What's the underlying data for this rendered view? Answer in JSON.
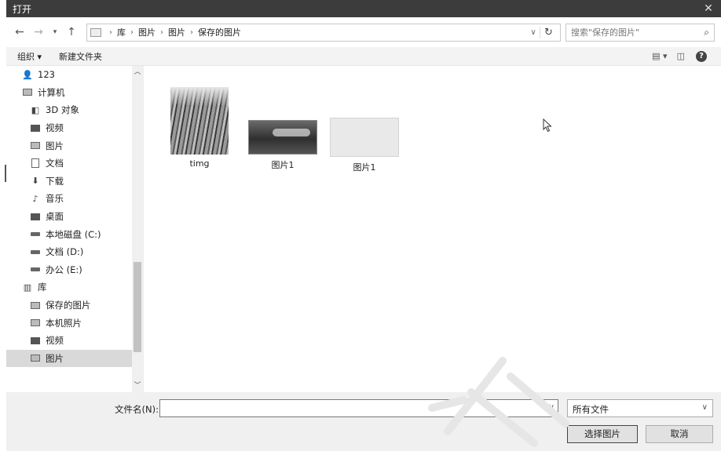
{
  "window": {
    "title": "打开",
    "close_glyph": "✕"
  },
  "address": {
    "crumbs": [
      "库",
      "图片",
      "图片",
      "保存的图片"
    ],
    "search_placeholder": "搜索\"保存的图片\""
  },
  "toolbar": {
    "organize": "组织 ▾",
    "new_folder": "新建文件夹",
    "view_toggle": "▤ ▾",
    "preview": "◫",
    "help": "?"
  },
  "sidebar": {
    "items": [
      {
        "label": "123",
        "icon": "user-icon"
      },
      {
        "label": "计算机",
        "icon": "computer-icon"
      },
      {
        "label": "3D 对象",
        "icon": "cube-icon"
      },
      {
        "label": "视频",
        "icon": "video-icon"
      },
      {
        "label": "图片",
        "icon": "pictures-icon"
      },
      {
        "label": "文档",
        "icon": "document-icon"
      },
      {
        "label": "下载",
        "icon": "download-icon"
      },
      {
        "label": "音乐",
        "icon": "music-icon"
      },
      {
        "label": "桌面",
        "icon": "desktop-icon"
      },
      {
        "label": "本地磁盘 (C:)",
        "icon": "drive-icon"
      },
      {
        "label": "文档 (D:)",
        "icon": "drive-icon"
      },
      {
        "label": "办公 (E:)",
        "icon": "drive-icon"
      },
      {
        "label": "库",
        "icon": "library-icon"
      },
      {
        "label": "保存的图片",
        "icon": "pictures-icon"
      },
      {
        "label": "本机照片",
        "icon": "pictures-icon"
      },
      {
        "label": "视频",
        "icon": "video-icon"
      },
      {
        "label": "图片",
        "icon": "pictures-icon",
        "selected": true
      }
    ]
  },
  "files": [
    {
      "name": "timg"
    },
    {
      "name": "图片1"
    },
    {
      "name": "图片1"
    }
  ],
  "bottom": {
    "filename_label": "文件名(N):",
    "filename_value": "",
    "filter_value": "所有文件",
    "open_button": "选择图片",
    "cancel_button": "取消"
  }
}
